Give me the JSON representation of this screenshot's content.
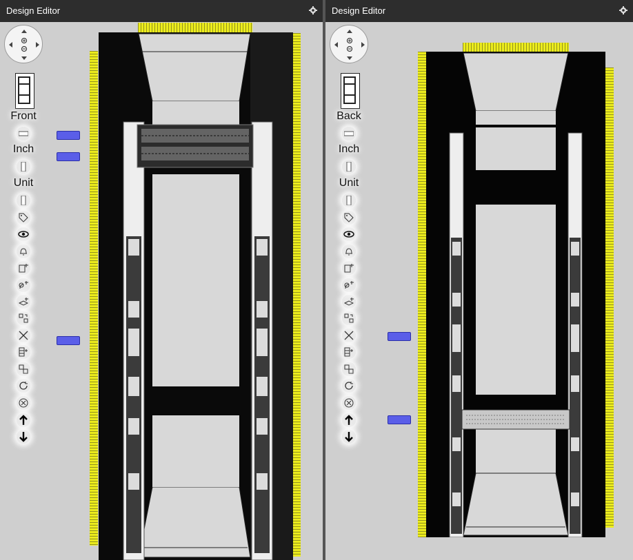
{
  "panels": [
    {
      "title": "Design Editor",
      "view_label": "Front",
      "inch_label": "Inch",
      "unit_label": "Unit",
      "tools": [
        "bar-icon",
        "inch-toggle-icon",
        "unit-toggle-icon",
        "tag-icon",
        "eye-icon",
        "bell-icon",
        "add-device-icon",
        "add-cable-icon",
        "add-shelf-icon",
        "arrange-icon",
        "delete-icon",
        "list-add-icon",
        "swap-icon",
        "refresh-icon",
        "cancel-icon",
        "arrow-up-icon",
        "arrow-down-icon"
      ],
      "installed_device": "patch-panel-48-port"
    },
    {
      "title": "Design Editor",
      "view_label": "Back",
      "inch_label": "Inch",
      "unit_label": "Unit",
      "tools": [
        "bar-icon",
        "inch-toggle-icon",
        "unit-toggle-icon",
        "tag-icon",
        "eye-icon",
        "bell-icon",
        "add-device-icon",
        "add-cable-icon",
        "add-shelf-icon",
        "arrange-icon",
        "delete-icon",
        "list-add-icon",
        "swap-icon",
        "refresh-icon",
        "cancel-icon",
        "arrow-up-icon",
        "arrow-down-icon"
      ],
      "installed_device": "server-1u-vented"
    }
  ],
  "colors": {
    "titlebar": "#2d2d2d",
    "background": "#cfcfcf",
    "ruler": "#ecec1c",
    "marker": "#5a5ee8",
    "rack": "#000000"
  }
}
